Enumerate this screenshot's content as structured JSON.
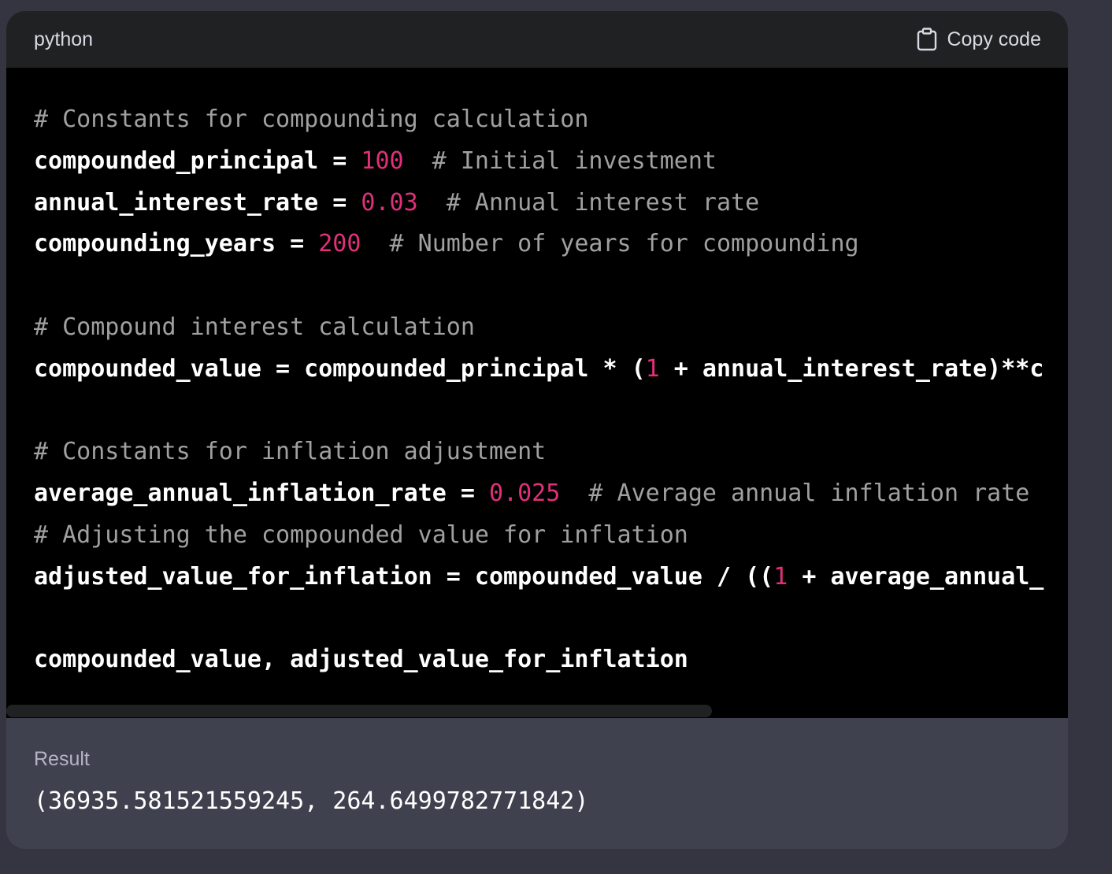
{
  "code_block": {
    "language": "python",
    "copy_label": "Copy code",
    "copy_icon": "clipboard-icon",
    "lines": [
      [
        {
          "t": "# Constants for compounding calculation",
          "k": "comment"
        }
      ],
      [
        {
          "t": "compounded_principal = ",
          "k": "plain"
        },
        {
          "t": "100",
          "k": "num"
        },
        {
          "t": "  ",
          "k": "plain"
        },
        {
          "t": "# Initial investment",
          "k": "comment"
        }
      ],
      [
        {
          "t": "annual_interest_rate = ",
          "k": "plain"
        },
        {
          "t": "0.03",
          "k": "num"
        },
        {
          "t": "  ",
          "k": "plain"
        },
        {
          "t": "# Annual interest rate",
          "k": "comment"
        }
      ],
      [
        {
          "t": "compounding_years = ",
          "k": "plain"
        },
        {
          "t": "200",
          "k": "num"
        },
        {
          "t": "  ",
          "k": "plain"
        },
        {
          "t": "# Number of years for compounding",
          "k": "comment"
        }
      ],
      [],
      [
        {
          "t": "# Compound interest calculation",
          "k": "comment"
        }
      ],
      [
        {
          "t": "compounded_value = compounded_principal * (",
          "k": "plain"
        },
        {
          "t": "1",
          "k": "num"
        },
        {
          "t": " + annual_interest_rate)**c",
          "k": "plain"
        }
      ],
      [],
      [
        {
          "t": "# Constants for inflation adjustment",
          "k": "comment"
        }
      ],
      [
        {
          "t": "average_annual_inflation_rate = ",
          "k": "plain"
        },
        {
          "t": "0.025",
          "k": "num"
        },
        {
          "t": "  ",
          "k": "plain"
        },
        {
          "t": "# Average annual inflation rate",
          "k": "comment"
        }
      ],
      [
        {
          "t": "# Adjusting the compounded value for inflation",
          "k": "comment"
        }
      ],
      [
        {
          "t": "adjusted_value_for_inflation = compounded_value / ((",
          "k": "plain"
        },
        {
          "t": "1",
          "k": "num"
        },
        {
          "t": " + average_annual_",
          "k": "plain"
        }
      ],
      [],
      [
        {
          "t": "compounded_value, adjusted_value_for_inflation",
          "k": "plain"
        }
      ]
    ]
  },
  "result": {
    "label": "Result",
    "value": "(36935.581521559245, 264.6499782771842)"
  },
  "colors": {
    "page_bg": "#343541",
    "header_bg": "#202123",
    "code_bg": "#000000",
    "result_bg": "#40414f",
    "comment": "#a0a0a0",
    "number": "#df3079"
  }
}
